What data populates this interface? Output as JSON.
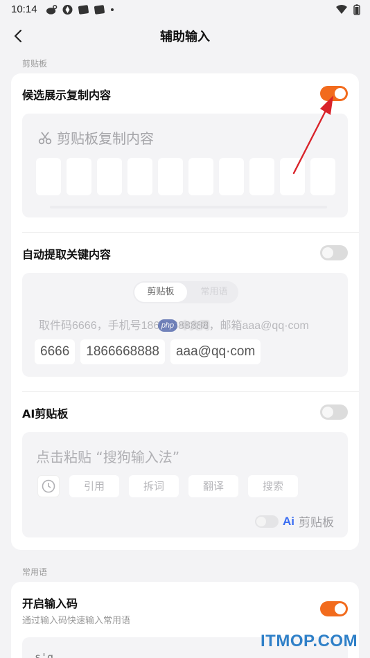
{
  "status_bar": {
    "time": "10:14"
  },
  "header": {
    "title": "辅助输入"
  },
  "clipboard_section": {
    "label": "剪贴板",
    "show_copied": {
      "title": "候选展示复制内容",
      "enabled": true,
      "preview_title": "剪贴板复制内容"
    },
    "auto_extract": {
      "title": "自动提取关键内容",
      "enabled": false,
      "tabs": [
        "剪贴板",
        "常用语"
      ],
      "source_text": "取件码6666，手机号18666688888，邮箱aaa@qq·com",
      "chips": [
        "6666",
        "1866668888",
        "aaa@qq·com"
      ]
    },
    "ai_clipboard": {
      "title": "AI剪贴板",
      "enabled": false,
      "hint": "点击粘贴 “搜狗输入法”",
      "tools": [
        "引用",
        "拆词",
        "翻译",
        "搜索"
      ],
      "badge": "Ai",
      "footer_label": "剪贴板"
    }
  },
  "phrases_section": {
    "label": "常用语",
    "input_code": {
      "title": "开启输入码",
      "subtitle": "通过输入码快速输入常用语",
      "enabled": true,
      "preview_text": "s'g"
    }
  },
  "watermarks": {
    "center_logo": "php",
    "center_text": "中文网",
    "corner": "ITMOP.COM"
  },
  "colors": {
    "accent": "#f26b1d",
    "arrow": "#d9232a",
    "ai_blue": "#3b6ef2"
  }
}
